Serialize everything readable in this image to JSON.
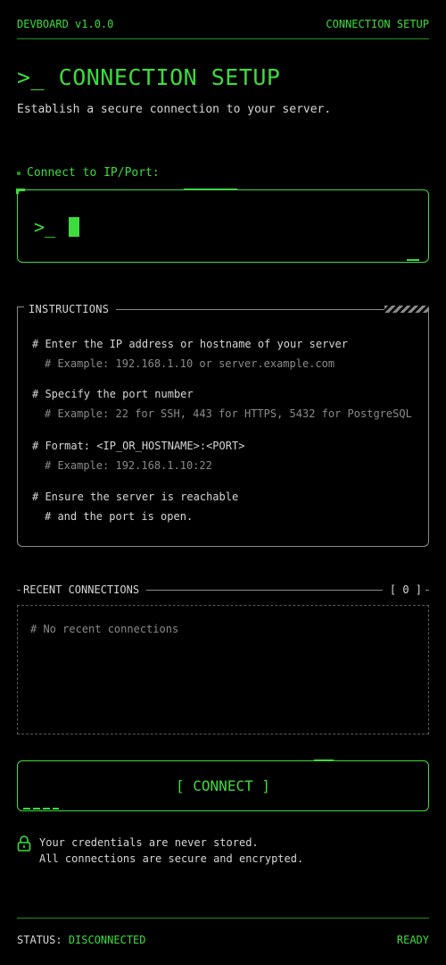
{
  "header": {
    "app_name": "DEVBOARD v1.0.0",
    "section": "CONNECTION SETUP"
  },
  "page": {
    "title": ">_ CONNECTION SETUP",
    "subtitle": "Establish a secure connection to your server."
  },
  "input": {
    "label": "Connect to IP/Port:",
    "prompt": ">_",
    "value": ""
  },
  "instructions": {
    "heading": "INSTRUCTIONS",
    "lines": [
      {
        "text": "# Enter the IP address or hostname of your server",
        "dim": false
      },
      {
        "text": "# Example: 192.168.1.10 or server.example.com",
        "dim": true
      },
      {
        "text": "# Specify the port number",
        "dim": false
      },
      {
        "text": "# Example: 22 for SSH, 443 for HTTPS, 5432 for PostgreSQL",
        "dim": true
      },
      {
        "text": "# Format: <IP_OR_HOSTNAME>:<PORT>",
        "dim": false
      },
      {
        "text": "# Example: 192.168.1.10:22",
        "dim": true
      },
      {
        "text": "# Ensure the server is reachable",
        "dim": false
      },
      {
        "text": "# and the port is open.",
        "dim": false
      }
    ]
  },
  "recent": {
    "heading": "RECENT CONNECTIONS",
    "count": "[ 0 ]",
    "empty_text": "# No recent connections"
  },
  "connect_button": {
    "label": "[ CONNECT ]"
  },
  "security_note": {
    "line1": "Your credentials are never stored.",
    "line2": "All connections are secure and encrypted."
  },
  "footer": {
    "status_label": "STATUS:",
    "status_value": "DISCONNECTED",
    "state": "READY"
  },
  "colors": {
    "accent": "#3ddc3d",
    "accent_dim": "#1f8f1f",
    "muted": "#8a8a8a",
    "background": "#000000"
  },
  "icons": {
    "lock": "lock-icon"
  }
}
